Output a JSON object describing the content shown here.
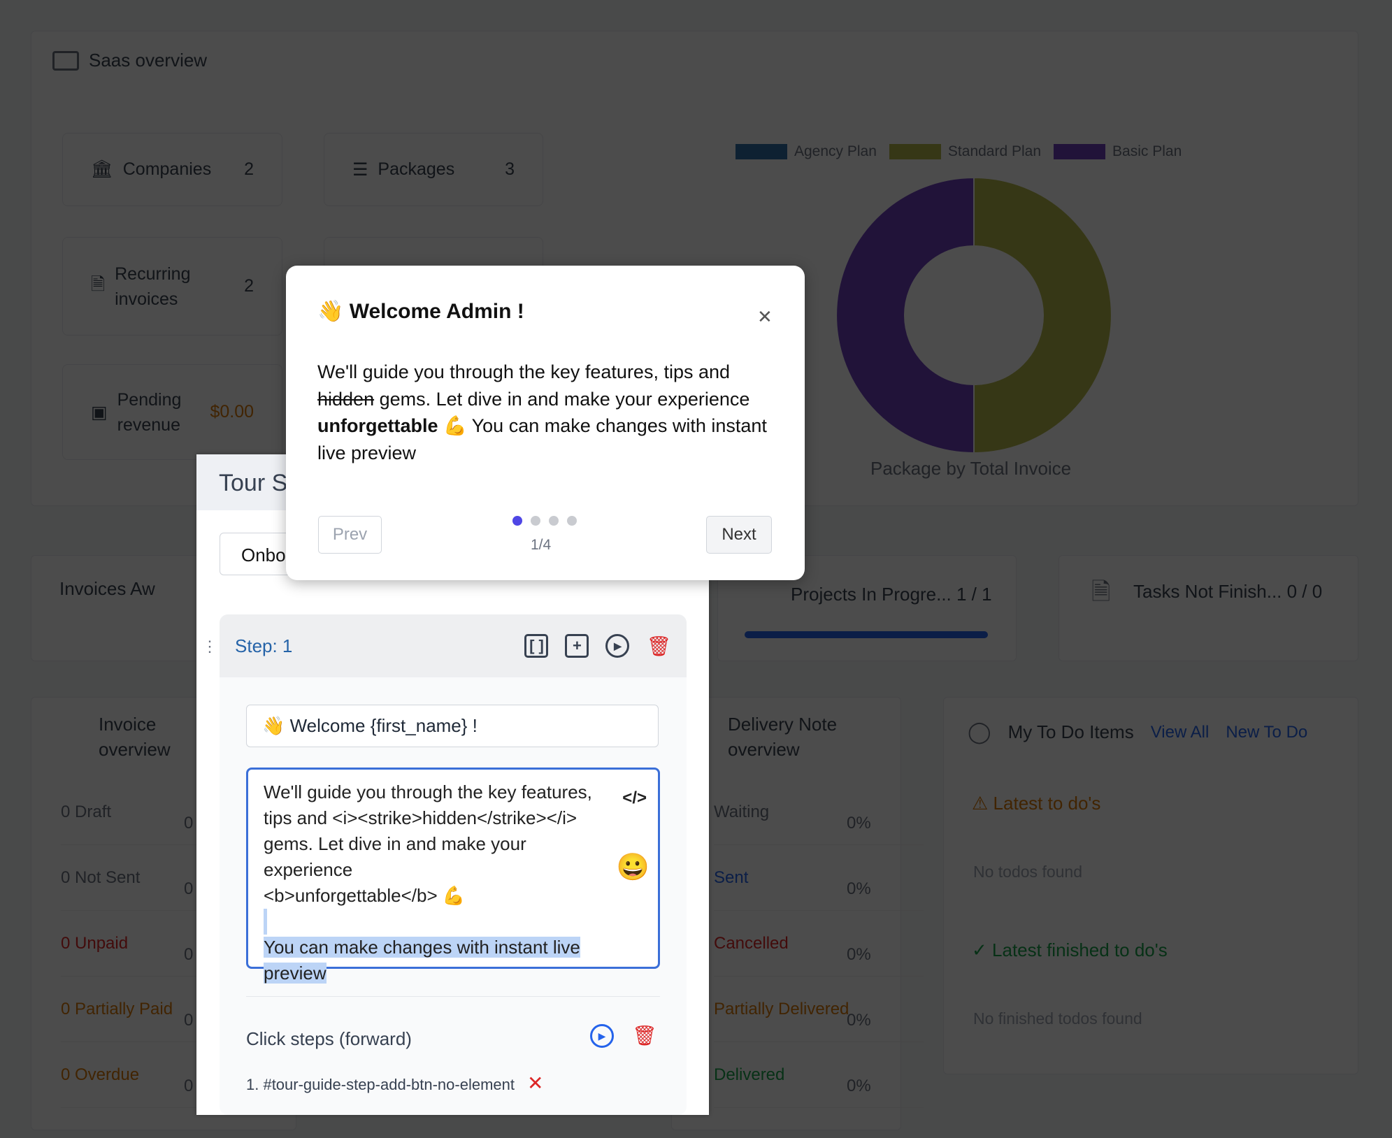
{
  "saas": {
    "title": "Saas overview",
    "cards": [
      {
        "label": "Companies",
        "value": "2"
      },
      {
        "label": "Packages",
        "value": "3"
      },
      {
        "label": "Recurring invoices",
        "value": "2"
      },
      {
        "label": "Pending revenue",
        "value": "$0.00"
      }
    ],
    "chart_data": {
      "type": "pie",
      "title": "Package by Total Invoice",
      "categories": [
        "Agency Plan",
        "Standard Plan",
        "Basic Plan"
      ],
      "values": [
        0,
        1,
        1
      ],
      "colors": [
        "#2f6fa8",
        "#b5b84a",
        "#6f3fbf"
      ],
      "legend": "top"
    }
  },
  "row2": {
    "invoices_awaiting": "Invoices Aw",
    "projects": "Projects In Progre... 1 / 1",
    "projects_progress": 1.0,
    "tasks": "Tasks Not Finish... 0 / 0"
  },
  "invoice_overview": {
    "title": "Invoice overview",
    "rows": [
      {
        "label": "0 Draft",
        "color": "#6b7280",
        "pct": "0"
      },
      {
        "label": "0 Not Sent",
        "color": "#6b7280",
        "pct": "0"
      },
      {
        "label": "0 Unpaid",
        "color": "#dc2626",
        "pct": "0"
      },
      {
        "label": "0 Partially Paid",
        "color": "#d97706",
        "pct": "0"
      },
      {
        "label": "0 Overdue",
        "color": "#d97706",
        "pct": "0"
      }
    ]
  },
  "delivery": {
    "title": "Delivery Note overview",
    "rows": [
      {
        "label": "Waiting",
        "color": "#6b7280",
        "pct": "0%"
      },
      {
        "label": "Sent",
        "color": "#2563eb",
        "pct": "0%"
      },
      {
        "label": "Cancelled",
        "color": "#dc2626",
        "pct": "0%"
      },
      {
        "label": "Partially Delivered",
        "color": "#d97706",
        "pct": "0%"
      },
      {
        "label": "Delivered",
        "color": "#16a34a",
        "pct": "0%"
      }
    ]
  },
  "todo": {
    "title": "My To Do Items",
    "view_all": "View All",
    "new": "New To Do",
    "latest": "Latest to do's",
    "no_todos": "No todos found",
    "finished": "Latest finished to do's",
    "no_finished": "No finished todos found"
  },
  "tour": {
    "header": "Tour S",
    "select": "Onbo",
    "step_label": "Step: 1",
    "title_value": "👋 Welcome {first_name} !",
    "content_lines": [
      "We'll guide you through the key features,",
      "tips and <i><strike>hidden</strike></i>",
      "gems. Let dive in and make your experience",
      "<b>unforgettable</b> 💪"
    ],
    "content_selected": [
      "You can make changes with instant live",
      "preview"
    ],
    "click_steps": "Click steps (forward)",
    "click_item": "1. #tour-guide-step-add-btn-no-element"
  },
  "popover": {
    "emoji": "👋",
    "title": "Welcome Admin !",
    "body_pre": "We'll guide you through the key features, tips and ",
    "body_strike": "hidden",
    "body_mid": " gems. Let dive in and make your experience ",
    "body_bold": "unforgettable",
    "body_post": " 💪 You can make changes with instant live preview",
    "prev": "Prev",
    "next": "Next",
    "page": "1/4",
    "current_step": 1,
    "total_steps": 4
  }
}
